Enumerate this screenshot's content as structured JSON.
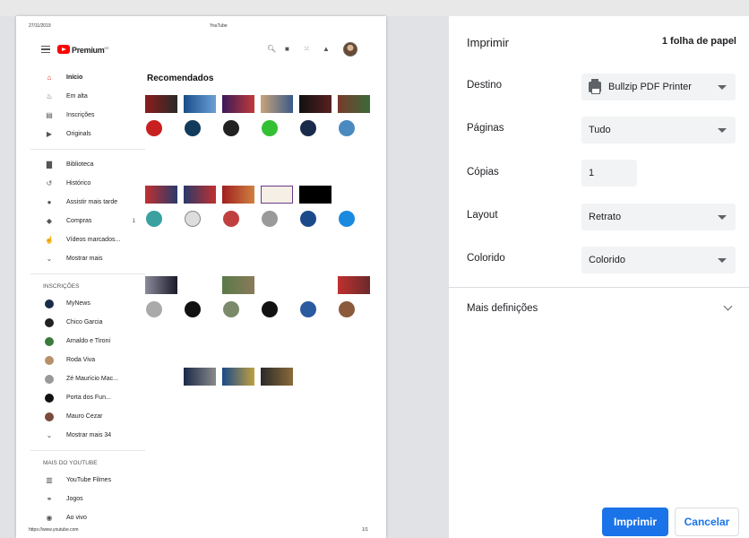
{
  "preview": {
    "date": "27/11/2019",
    "page_title": "YouTube",
    "url": "https://www.youtube.com",
    "page_num": "1/1",
    "brand": "Premium",
    "recommended_title": "Recomendados",
    "sidebar": {
      "main": [
        {
          "label": "Início",
          "icon": "home-icon"
        },
        {
          "label": "Em alta",
          "icon": "flame-icon"
        },
        {
          "label": "Inscrições",
          "icon": "subscriptions-icon"
        },
        {
          "label": "Originals",
          "icon": "originals-icon"
        }
      ],
      "library": [
        {
          "label": "Biblioteca",
          "icon": "folder-icon"
        },
        {
          "label": "Histórico",
          "icon": "history-icon"
        },
        {
          "label": "Assistir mais tarde",
          "icon": "clock-icon"
        },
        {
          "label": "Compras",
          "icon": "tag-icon",
          "count": "1"
        },
        {
          "label": "Vídeos marcados...",
          "icon": "thumb-up-icon"
        },
        {
          "label": "Mostrar mais",
          "icon": "chevron-down-icon"
        }
      ],
      "subscriptions_title": "INSCRIÇÕES",
      "subscriptions": [
        {
          "label": "MyNews"
        },
        {
          "label": "Chico Garcia"
        },
        {
          "label": "Arnaldo e Tironi"
        },
        {
          "label": "Roda Viva"
        },
        {
          "label": "Zé Maurício Mac..."
        },
        {
          "label": "Porta dos Fun..."
        },
        {
          "label": "Mauro Cezar"
        },
        {
          "label": "Mostrar mais 34"
        }
      ],
      "more_title": "MAIS DO YOUTUBE",
      "more": [
        {
          "label": "YouTube Filmes",
          "icon": "film-icon"
        },
        {
          "label": "Jogos",
          "icon": "gamepad-icon"
        },
        {
          "label": "Ao vivo",
          "icon": "live-icon"
        }
      ]
    }
  },
  "print": {
    "title": "Imprimir",
    "sheets": "1 folha de papel",
    "destination_label": "Destino",
    "destination_value": "Bullzip PDF Printer",
    "pages_label": "Páginas",
    "pages_value": "Tudo",
    "copies_label": "Cópias",
    "copies_value": "1",
    "layout_label": "Layout",
    "layout_value": "Retrato",
    "color_label": "Colorido",
    "color_value": "Colorido",
    "more_settings": "Mais definições",
    "print_button": "Imprimir",
    "cancel_button": "Cancelar"
  },
  "colors": {
    "accent": "#1a73e8",
    "yt_red": "#ff0000"
  }
}
